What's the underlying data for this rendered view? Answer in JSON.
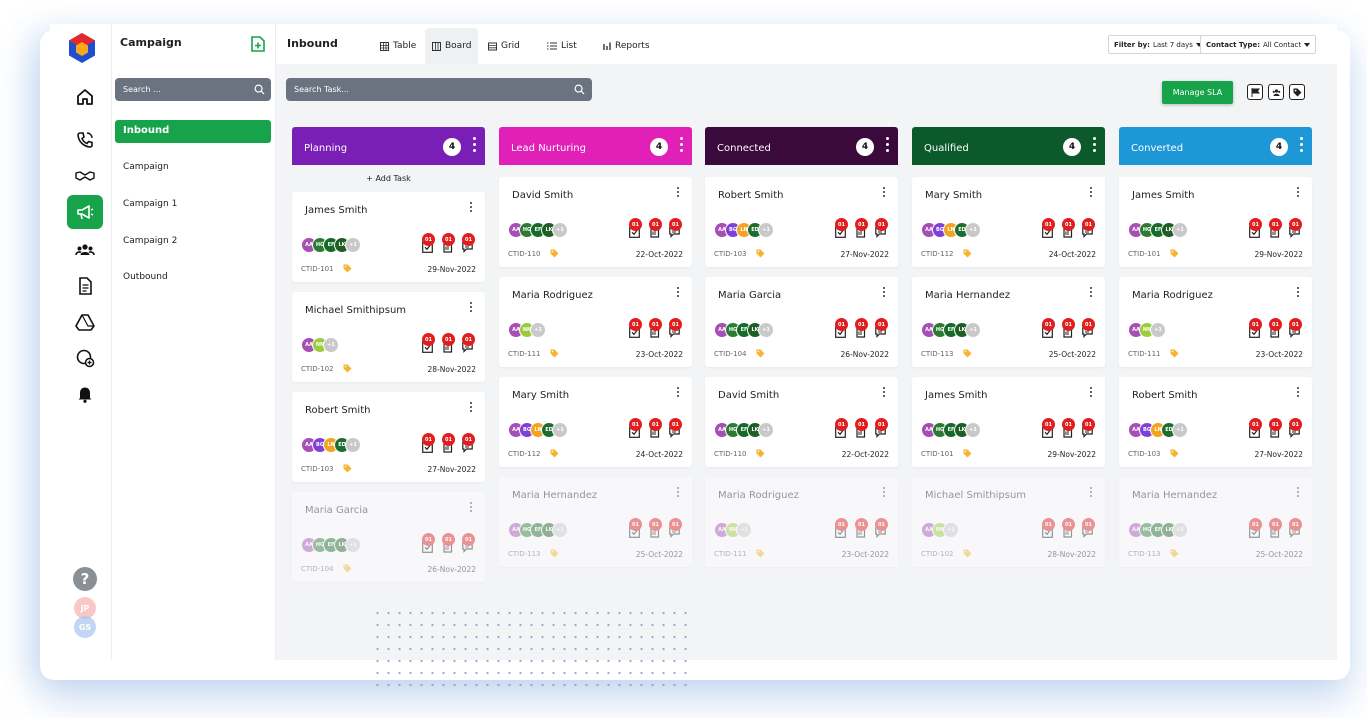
{
  "app": {
    "section_title": "Campaign",
    "page_title": "Inbound",
    "rail_avatars": [
      "JP",
      "GS"
    ]
  },
  "sidebar": {
    "search_placeholder": "Search ...",
    "items": [
      {
        "label": "Inbound",
        "active": true
      },
      {
        "label": "Campaign",
        "active": false
      },
      {
        "label": "Campaign 1",
        "active": false
      },
      {
        "label": "Campaign 2",
        "active": false
      },
      {
        "label": "Outbound",
        "active": false
      }
    ]
  },
  "views": [
    {
      "label": "Table",
      "icon": "table-icon",
      "active": false
    },
    {
      "label": "Board",
      "icon": "board-icon",
      "active": true
    },
    {
      "label": "Grid",
      "icon": "grid-icon",
      "active": false
    },
    {
      "label": "List",
      "icon": "list-icon",
      "active": false
    },
    {
      "label": "Reports",
      "icon": "reports-icon",
      "active": false
    }
  ],
  "filters": {
    "filter_by_label": "Filter by:",
    "filter_by_value": "Last 7 days",
    "contact_type_label": "Contact Type:",
    "contact_type_value": "All Contact"
  },
  "task_search_placeholder": "Search Task...",
  "manage_sla_label": "Manage SLA",
  "add_task_label": "+ Add Task",
  "colors": {
    "accent": "#16a34a",
    "badge": "#e11d1d"
  },
  "columns": [
    {
      "name": "Planning",
      "count": "4",
      "color": "#7a1fb5",
      "cards": [
        {
          "name": "James Smith",
          "id": "CTID-101",
          "date": "29-Nov-2022",
          "avatars": [
            "AA",
            "HG",
            "EF",
            "LK",
            "+1"
          ],
          "counts": [
            "01",
            "01",
            "01"
          ],
          "faded": false
        },
        {
          "name": "Michael Smithipsum",
          "id": "CTID-102",
          "date": "28-Nov-2022",
          "avatars": [
            "AA",
            "NN",
            "+1"
          ],
          "counts": [
            "01",
            "01",
            "01"
          ],
          "faded": false
        },
        {
          "name": "Robert Smith",
          "id": "CTID-103",
          "date": "27-Nov-2022",
          "avatars": [
            "AA",
            "BG",
            "LN",
            "ED",
            "+1"
          ],
          "counts": [
            "01",
            "01",
            "01"
          ],
          "faded": false
        },
        {
          "name": "Maria Garcia",
          "id": "CTID-104",
          "date": "26-Nov-2022",
          "avatars": [
            "AA",
            "HG",
            "EF",
            "LK",
            "+1"
          ],
          "counts": [
            "01",
            "01",
            "01"
          ],
          "faded": true
        }
      ]
    },
    {
      "name": "Lead Nurturing",
      "count": "4",
      "color": "#e020b7",
      "cards": [
        {
          "name": "David Smith",
          "id": "CTID-110",
          "date": "22-Oct-2022",
          "avatars": [
            "AA",
            "HG",
            "EF",
            "LK",
            "+1"
          ],
          "counts": [
            "01",
            "01",
            "01"
          ],
          "faded": false
        },
        {
          "name": "Maria Rodriguez",
          "id": "CTID-111",
          "date": "23-Oct-2022",
          "avatars": [
            "AA",
            "NN",
            "+1"
          ],
          "counts": [
            "01",
            "01",
            "01"
          ],
          "faded": false
        },
        {
          "name": "Mary Smith",
          "id": "CTID-112",
          "date": "24-Oct-2022",
          "avatars": [
            "AA",
            "BG",
            "LN",
            "ED",
            "+1"
          ],
          "counts": [
            "01",
            "01",
            "01"
          ],
          "faded": false
        },
        {
          "name": "Maria Hernandez",
          "id": "CTID-113",
          "date": "25-Oct-2022",
          "avatars": [
            "AA",
            "HG",
            "EF",
            "LK",
            "+1"
          ],
          "counts": [
            "01",
            "01",
            "01"
          ],
          "faded": true
        }
      ]
    },
    {
      "name": "Connected",
      "count": "4",
      "color": "#3b0a3d",
      "cards": [
        {
          "name": "Robert Smith",
          "id": "CTID-103",
          "date": "27-Nov-2022",
          "avatars": [
            "AA",
            "BG",
            "LN",
            "ED",
            "+1"
          ],
          "counts": [
            "01",
            "01",
            "01"
          ],
          "faded": false
        },
        {
          "name": "Maria Garcia",
          "id": "CTID-104",
          "date": "26-Nov-2022",
          "avatars": [
            "AA",
            "HG",
            "EF",
            "LK",
            "+1"
          ],
          "counts": [
            "01",
            "01",
            "01"
          ],
          "faded": false
        },
        {
          "name": "David Smith",
          "id": "CTID-110",
          "date": "22-Oct-2022",
          "avatars": [
            "AA",
            "HG",
            "EF",
            "LK",
            "+1"
          ],
          "counts": [
            "01",
            "01",
            "01"
          ],
          "faded": false
        },
        {
          "name": "Maria Rodriguez",
          "id": "CTID-111",
          "date": "23-Oct-2022",
          "avatars": [
            "AA",
            "NN",
            "+1"
          ],
          "counts": [
            "01",
            "01",
            "01"
          ],
          "faded": true
        }
      ]
    },
    {
      "name": "Qualified",
      "count": "4",
      "color": "#0c5a2c",
      "cards": [
        {
          "name": "Mary Smith",
          "id": "CTID-112",
          "date": "24-Oct-2022",
          "avatars": [
            "AA",
            "BG",
            "LN",
            "ED",
            "+1"
          ],
          "counts": [
            "01",
            "01",
            "01"
          ],
          "faded": false
        },
        {
          "name": "Maria Hernandez",
          "id": "CTID-113",
          "date": "25-Oct-2022",
          "avatars": [
            "AA",
            "HG",
            "EF",
            "LK",
            "+1"
          ],
          "counts": [
            "01",
            "01",
            "01"
          ],
          "faded": false
        },
        {
          "name": "James Smith",
          "id": "CTID-101",
          "date": "29-Nov-2022",
          "avatars": [
            "AA",
            "HG",
            "EF",
            "LK",
            "+1"
          ],
          "counts": [
            "01",
            "01",
            "01"
          ],
          "faded": false
        },
        {
          "name": "Michael Smithipsum",
          "id": "CTID-102",
          "date": "28-Nov-2022",
          "avatars": [
            "AA",
            "NN",
            "+1"
          ],
          "counts": [
            "01",
            "01",
            "01"
          ],
          "faded": true
        }
      ]
    },
    {
      "name": "Converted",
      "count": "4",
      "color": "#1e97d6",
      "cards": [
        {
          "name": "James Smith",
          "id": "CTID-101",
          "date": "29-Nov-2022",
          "avatars": [
            "AA",
            "HG",
            "EF",
            "LK",
            "+1"
          ],
          "counts": [
            "01",
            "01",
            "01"
          ],
          "faded": false
        },
        {
          "name": "Maria Rodriguez",
          "id": "CTID-111",
          "date": "23-Oct-2022",
          "avatars": [
            "AA",
            "NN",
            "+1"
          ],
          "counts": [
            "01",
            "01",
            "01"
          ],
          "faded": false
        },
        {
          "name": "Robert Smith",
          "id": "CTID-103",
          "date": "27-Nov-2022",
          "avatars": [
            "AA",
            "BG",
            "LN",
            "ED",
            "+1"
          ],
          "counts": [
            "01",
            "01",
            "01"
          ],
          "faded": false
        },
        {
          "name": "Maria Hernandez",
          "id": "CTID-113",
          "date": "25-Oct-2022",
          "avatars": [
            "AA",
            "HG",
            "EF",
            "LK",
            "+1"
          ],
          "counts": [
            "01",
            "01",
            "01"
          ],
          "faded": true
        }
      ]
    }
  ]
}
